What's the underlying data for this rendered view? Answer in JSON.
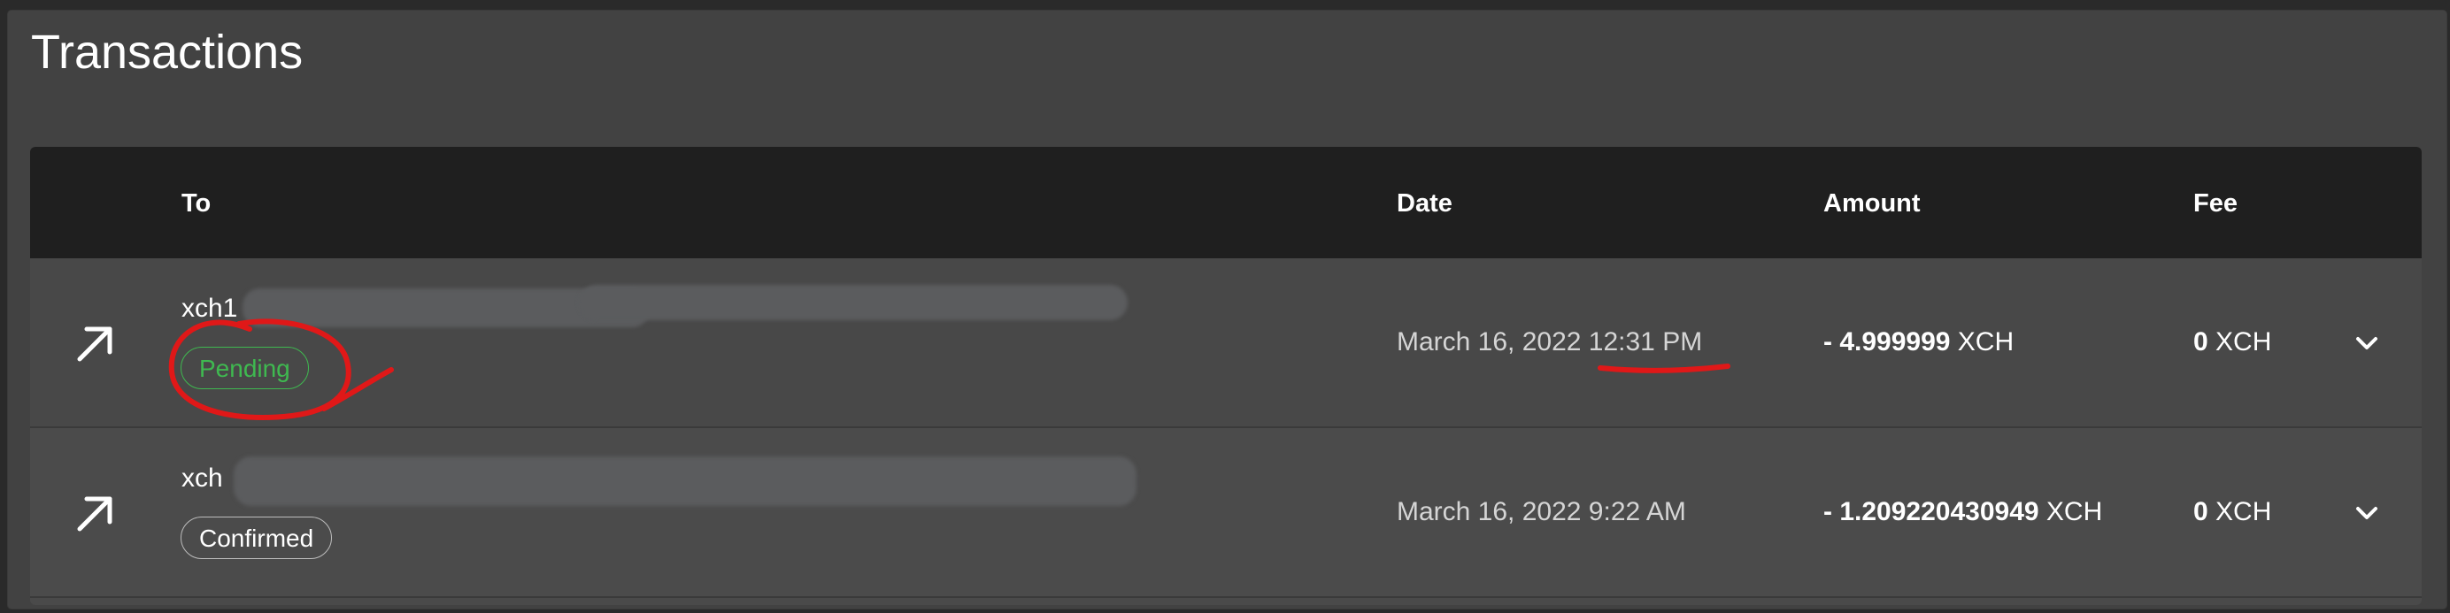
{
  "page": {
    "title": "Transactions"
  },
  "table": {
    "headers": {
      "to": "To",
      "date": "Date",
      "amount": "Amount",
      "fee": "Fee"
    },
    "rows": [
      {
        "to_prefix": "xch1",
        "status": "Pending",
        "date": "March 16, 2022 12:31 PM",
        "amount_value": "- 4.999999",
        "amount_unit": "XCH",
        "fee_value": "0",
        "fee_unit": "XCH",
        "direction_icon": "arrow-up-right-icon",
        "expand_icon": "chevron-down-icon"
      },
      {
        "to_prefix": "xch",
        "status": "Confirmed",
        "date": "March 16, 2022 9:22 AM",
        "amount_value": "- 1.209220430949",
        "amount_unit": "XCH",
        "fee_value": "0",
        "fee_unit": "XCH",
        "direction_icon": "arrow-up-right-icon",
        "expand_icon": "chevron-down-icon"
      }
    ]
  },
  "colors": {
    "pending": "#3fb950",
    "annotation": "#e01818",
    "header_bg": "#1f1f1f",
    "panel_bg": "#424242"
  }
}
